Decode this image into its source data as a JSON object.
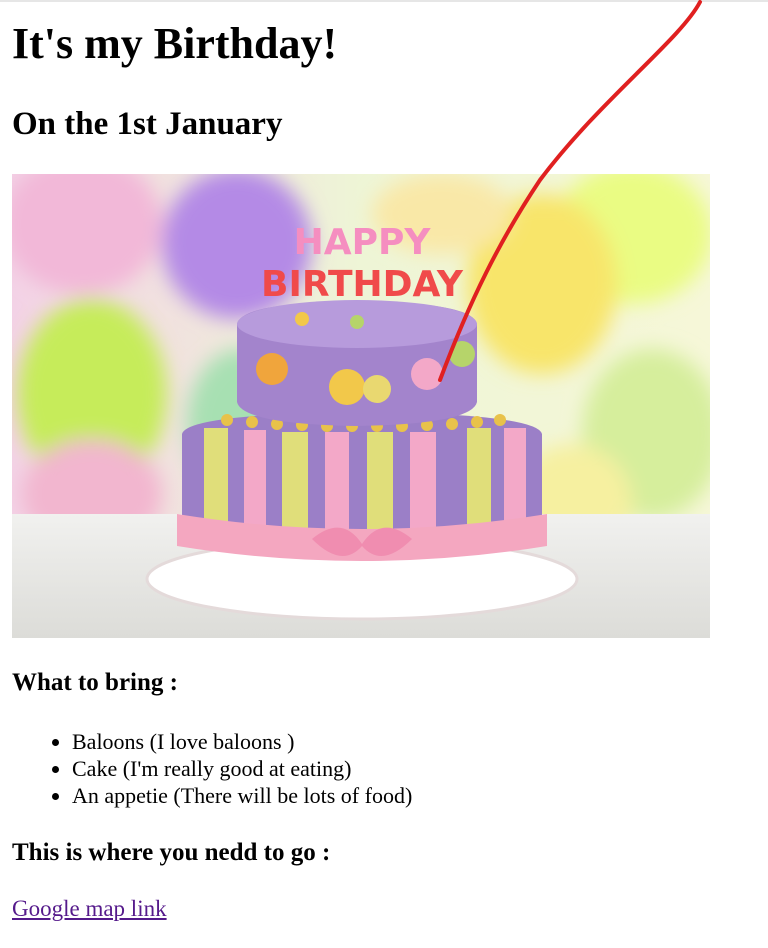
{
  "page": {
    "title": "It's my Birthday!",
    "subtitle": "On the 1st January",
    "image": {
      "candle_text_top": "HAPPY",
      "candle_text_bottom": "BIRTHDAY"
    },
    "bring_heading": "What to bring :",
    "bring_items": [
      "Baloons (I love baloons )",
      "Cake (I'm really good at eating)",
      "An appetie (There will be lots of food)"
    ],
    "where_heading": "This is where you nedd to go :",
    "map_link_label": "Google map link"
  },
  "colors": {
    "link_visited": "#551a8b",
    "annotation_stroke": "#e02020",
    "cake_purple": "#9b7fc7",
    "frosting_pink": "#f4a7c0"
  }
}
